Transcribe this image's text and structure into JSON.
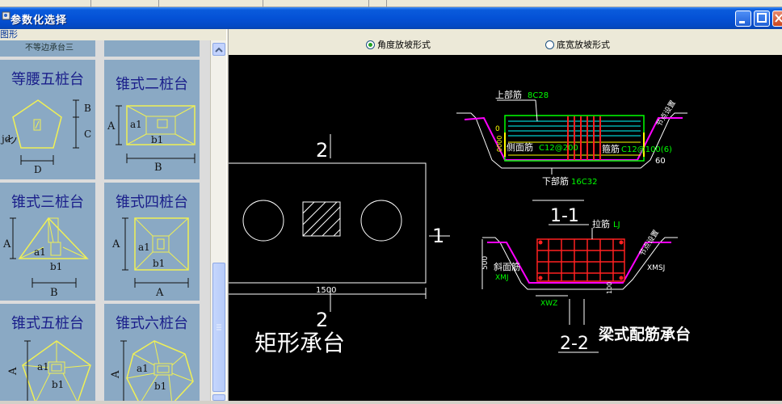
{
  "window": {
    "title": "参数化选择"
  },
  "menu": {
    "label": "图形"
  },
  "options": [
    {
      "label": "角度放坡形式",
      "selected": true
    },
    {
      "label": "底宽放坡形式",
      "selected": false
    }
  ],
  "tiles": {
    "stub": "不等边承台三",
    "t1": {
      "title": "等腰五桩台",
      "labels": {
        "b": "B",
        "c": "C",
        "d": "D",
        "jd": "jd"
      }
    },
    "t2": {
      "title": "锥式二桩台",
      "labels": {
        "a": "A",
        "a1": "a1",
        "b1": "b1",
        "b": "B"
      }
    },
    "t3": {
      "title": "锥式三桩台",
      "labels": {
        "a": "A",
        "a1": "a1",
        "b1": "b1",
        "b": "B"
      }
    },
    "t4": {
      "title": "锥式四桩台",
      "labels": {
        "a": "A",
        "a1": "a1",
        "b1": "b1",
        "b": "A"
      }
    },
    "t5": {
      "title": "锥式五桩台",
      "labels": {
        "a": "A",
        "a1": "a1",
        "b1": "b1"
      }
    },
    "t6": {
      "title": "锥式六桩台",
      "labels": {
        "a": "A",
        "a1": "a1",
        "b1": "b1"
      }
    }
  },
  "drawing": {
    "rect": {
      "title": "矩形承台",
      "sec_top": "2",
      "sec_bottom": "2",
      "sec_right": "1",
      "dim": "1500"
    },
    "s11": {
      "label": "1-1",
      "top_bar": "上部筋",
      "top_bar_val": "8C28",
      "side_bar": "侧面筋",
      "side_bar_val": "C12@200",
      "stirrup": "箍筋",
      "stirrup_val": "C12@100(6)",
      "bottom_bar": "下部筋",
      "bottom_bar_val": "16C32",
      "angle": "60",
      "dim_a": "0",
      "dim_b": "0000",
      "slope_note": "节点设置"
    },
    "s22": {
      "label": "2-2",
      "tie": "拉筋",
      "tie_val": "LJ",
      "slope_bar": "斜面筋",
      "xmj": "XMJ",
      "xmsj": "XMSJ",
      "xwz": "XWZ",
      "dim_500": "500",
      "dim_100": "100",
      "slope_note": "节点设置",
      "title": "梁式配筋承台"
    }
  },
  "colors": {
    "titlebar": "#0451d6",
    "tile_bg": "#8aa9c4",
    "tile_title": "#1a1e8a",
    "canvas": "#000000",
    "cad_white": "#ffffff",
    "cad_red": "#ff2020",
    "cad_green": "#00ff00",
    "cad_magenta": "#ff00ff",
    "cad_yellow": "#ffff00"
  }
}
